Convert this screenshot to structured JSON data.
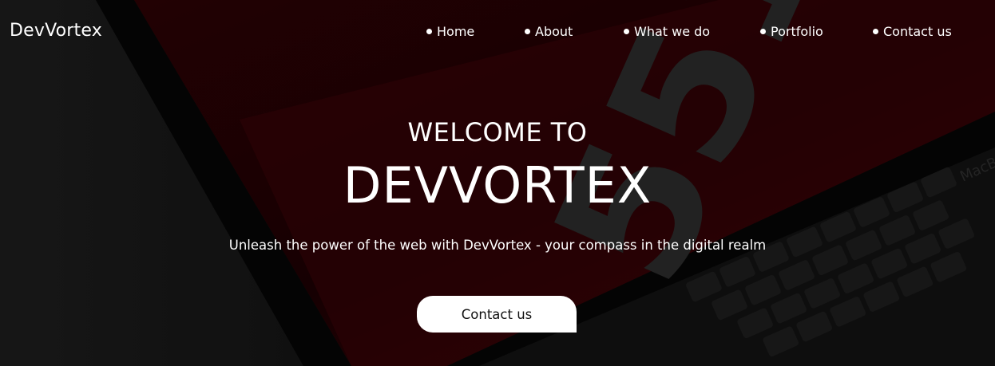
{
  "brand": {
    "name": "DevVortex"
  },
  "nav": {
    "items": [
      {
        "label": "Home"
      },
      {
        "label": "About"
      },
      {
        "label": "What we do"
      },
      {
        "label": "Portfolio"
      },
      {
        "label": "Contact us"
      }
    ]
  },
  "hero": {
    "welcome": "WELCOME TO",
    "title": "DEVVORTEX",
    "tagline": "Unleash the power of the web with DevVortex - your compass in the digital realm",
    "cta_label": "Contact us"
  },
  "background": {
    "screen_text": "551",
    "keyboard_brand_text": "MacB",
    "accent_color": "#5a0606",
    "dark_color": "#0e0e0e"
  }
}
